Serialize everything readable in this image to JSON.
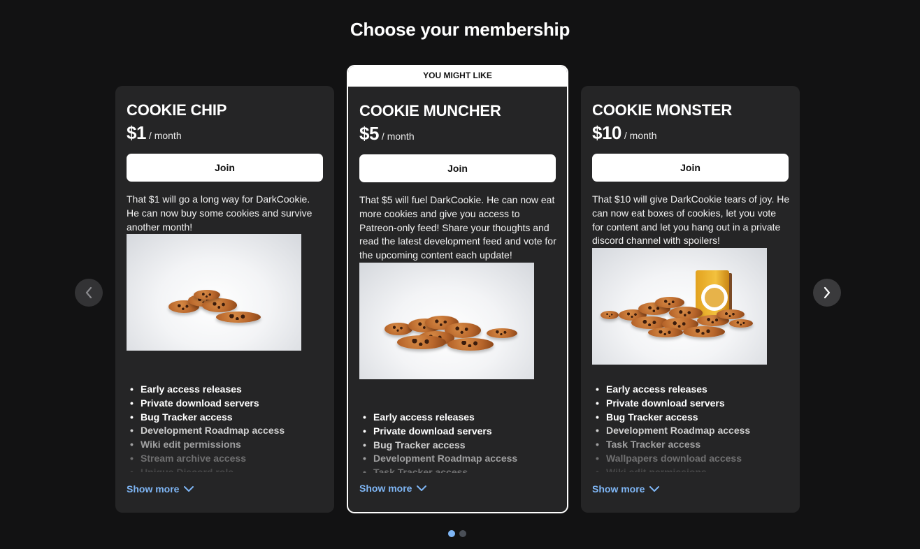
{
  "page": {
    "title": "Choose your membership"
  },
  "colors": {
    "background": "#121213",
    "card": "#252526",
    "accent_link": "#7fb6f5",
    "dot_active": "#7fb6f5",
    "dot_inactive": "#4a4f57"
  },
  "featured_tag": "YOU MIGHT LIKE",
  "tiers": [
    {
      "name": "COOKIE CHIP",
      "price": "$1",
      "period": "/ month",
      "join_label": "Join",
      "description": "That $1 will go a long way for DarkCookie. He can now buy some cookies and survive another month!",
      "image": "cookie-pile-small",
      "features": [
        "Early access releases",
        "Private download servers",
        "Bug Tracker access",
        "Development Roadmap access",
        "Wiki edit permissions",
        "Stream archive access",
        "Unique Discord role"
      ],
      "show_more": "Show more"
    },
    {
      "name": "COOKIE MUNCHER",
      "price": "$5",
      "period": "/ month",
      "join_label": "Join",
      "description": "That $5 will fuel DarkCookie. He can now eat more cookies and give you access to Patreon-only feed! Share your thoughts and read the latest development feed  and vote for the upcoming content each update!",
      "image": "cookie-pile-medium",
      "features": [
        "Early access releases",
        "Private download servers",
        "Bug Tracker access",
        "Development Roadmap access",
        "Task Tracker access"
      ],
      "show_more": "Show more"
    },
    {
      "name": "COOKIE MONSTER",
      "price": "$10",
      "period": "/ month",
      "join_label": "Join",
      "description": "That $10 will give DarkCookie tears of joy. He can now eat boxes of cookies, let you vote for content and let you hang  out in a private discord channel with spoilers!",
      "image": "cookie-pile-with-box",
      "features": [
        "Early access releases",
        "Private download servers",
        "Bug Tracker access",
        "Development Roadmap access",
        "Task Tracker access",
        "Wallpapers download access",
        "Wiki edit permissions"
      ],
      "show_more": "Show more"
    }
  ],
  "navigation": {
    "prev_icon": "chevron-left-icon",
    "next_icon": "chevron-right-icon"
  },
  "pagination": {
    "total": 2,
    "active": 1
  }
}
